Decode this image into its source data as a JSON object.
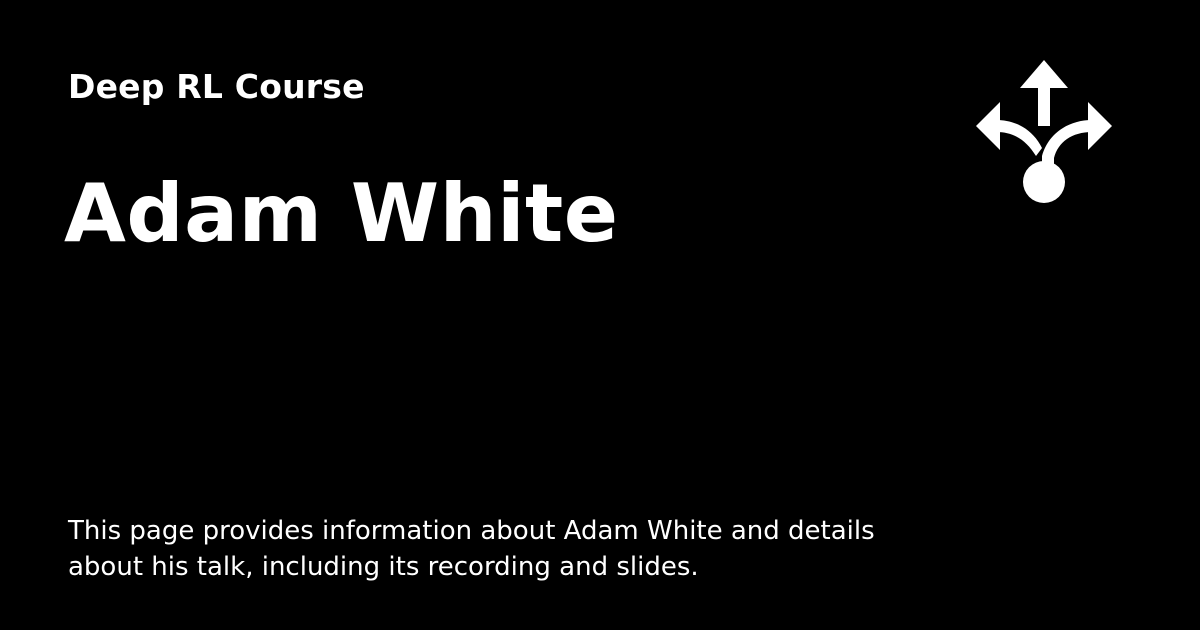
{
  "header": {
    "site_name": "Deep RL Course",
    "logo_icon": "branching-arrows-icon"
  },
  "main": {
    "title": "Adam White",
    "description": "This page provides information about Adam White and details about his talk, including its recording and slides."
  },
  "colors": {
    "background": "#000000",
    "text": "#ffffff"
  }
}
